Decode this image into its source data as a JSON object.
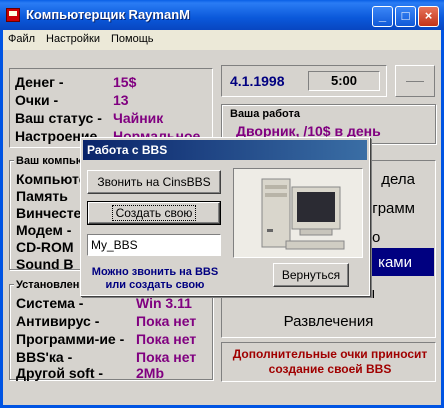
{
  "window": {
    "title": "Компьютерщик RaymanM"
  },
  "menu": [
    "Файл",
    "Настройки",
    "Помощь"
  ],
  "stats": {
    "money_label": "Денег -",
    "money_value": "15$",
    "points_label": "Очки -",
    "points_value": "13",
    "status_label": "Ваш статус -",
    "status_value": "Чайник",
    "mood_label": "Настроение",
    "mood_value": "Нормальное"
  },
  "date": "4.1.1998",
  "time": "5:00",
  "job": {
    "title": "Ваша работа",
    "value": "Дворник, /10$ в день"
  },
  "computer": {
    "title": "Ваш компьютер",
    "rows": [
      "Компьютер",
      "Память",
      "Винчестер",
      "Модем -",
      "CD-ROM",
      "Sound B"
    ]
  },
  "software": {
    "title": "Установленное",
    "rows": [
      {
        "label": "Система -",
        "value": "Win 3.11"
      },
      {
        "label": "Антивирус -",
        "value": "Пока нет"
      },
      {
        "label": "Программи-ие -",
        "value": "Пока нет"
      },
      {
        "label": "BBS'ка -",
        "value": "Пока нет"
      },
      {
        "label": "Другой soft -",
        "value": "2Mb"
      }
    ]
  },
  "right_menu": [
    "дела",
    "грамм",
    "о",
    "ками",
    "ты",
    "Развлечения"
  ],
  "hint": "Дополнительные очки приносит создание своей BBS",
  "dialog": {
    "title": "Работа с BBS",
    "call_button": "Звонить на CinsBBS",
    "create_button": "Создать свою",
    "name_value": "My_BBS",
    "info": "Можно звонить на BBS или создать свою",
    "back_button": "Вернуться"
  },
  "colors": {
    "accent": "#800080",
    "title": "#0054e3",
    "hint": "#a00000",
    "info": "#000080"
  }
}
